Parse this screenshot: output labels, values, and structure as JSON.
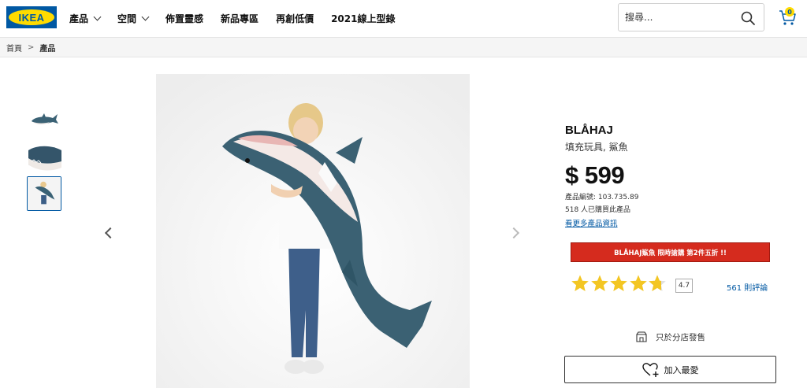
{
  "header": {
    "logo_text": "IKEA",
    "nav": [
      {
        "label": "產品"
      },
      {
        "label": "空間"
      },
      {
        "label": "佈置靈感"
      },
      {
        "label": "新品專區"
      },
      {
        "label": "再創低價"
      },
      {
        "label": "2021線上型錄"
      }
    ],
    "search_placeholder": "搜尋...",
    "cart_count": "0"
  },
  "breadcrumb": {
    "home": "首頁",
    "separator": ">",
    "current": "產品"
  },
  "product": {
    "name": "BLÅHAJ",
    "description": "填充玩具, 鯊魚",
    "price": "$ 599",
    "article_number": "產品編號: 103.735.89",
    "bought_count": "518 人已購買此產品",
    "more_info_link": "看更多產品資訊",
    "promo": "BLÅHAJ鯊魚 限時搶購 第2件五折 !!",
    "rating": "4.7",
    "reviews": "561 則評論",
    "store_only": "只於分店發售",
    "add_favorite": "加入最愛"
  },
  "colors": {
    "ikea_blue": "#0058a3",
    "ikea_yellow": "#ffdb00",
    "promo_red": "#d52b1e",
    "star": "#f3c623"
  },
  "icons": [
    "search-icon",
    "cart-icon",
    "chevron-left-icon",
    "chevron-right-icon",
    "star-icon",
    "store-icon",
    "heart-plus-icon"
  ]
}
